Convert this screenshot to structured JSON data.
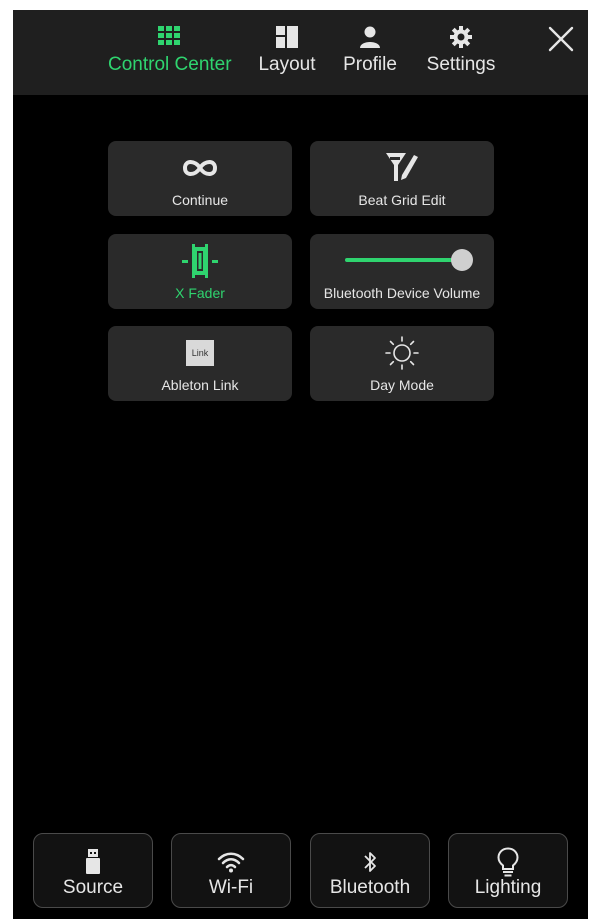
{
  "nav": {
    "tabs": [
      {
        "label": "Control Center",
        "icon": "grid-icon",
        "active": true
      },
      {
        "label": "Layout",
        "icon": "layout-icon",
        "active": false
      },
      {
        "label": "Profile",
        "icon": "user-icon",
        "active": false
      },
      {
        "label": "Settings",
        "icon": "gear-icon",
        "active": false
      }
    ],
    "close_icon": "close-icon"
  },
  "tiles": [
    {
      "label": "Continue",
      "icon": "infinity-icon"
    },
    {
      "label": "Beat Grid Edit",
      "icon": "beat-grid-edit-icon"
    },
    {
      "label": "X Fader",
      "icon": "crossfader-icon",
      "active": true
    },
    {
      "label": "Bluetooth Device Volume",
      "icon": "volume-slider",
      "volume": 0.9
    },
    {
      "label": "Ableton Link",
      "icon": "ableton-link-icon",
      "badge": "Link"
    },
    {
      "label": "Day Mode",
      "icon": "sun-icon"
    }
  ],
  "bottom": [
    {
      "label": "Source",
      "icon": "usb-icon"
    },
    {
      "label": "Wi-Fi",
      "icon": "wifi-icon"
    },
    {
      "label": "Bluetooth",
      "icon": "bluetooth-icon"
    },
    {
      "label": "Lighting",
      "icon": "bulb-icon"
    }
  ],
  "colors": {
    "accent": "#2fd46f",
    "background": "#000000",
    "topbar": "#1f1f1f",
    "tile": "#2a2a2a",
    "text": "#e6e6e6"
  }
}
